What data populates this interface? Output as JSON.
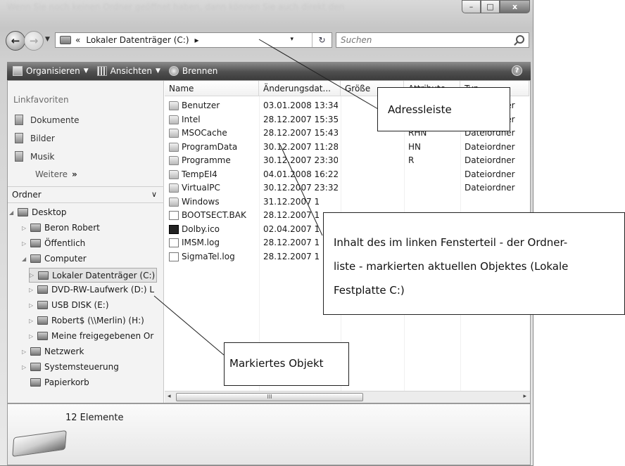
{
  "window": {
    "title_blurred": "Wenn Sie noch keinen Ordner geöffnet haben, dann können Sie auch direkt den",
    "caption_buttons": {
      "minimize": "–",
      "maximize": "□",
      "close": "x"
    }
  },
  "address_bar": {
    "prefix": "«",
    "location": "Lokaler Datenträger (C:)",
    "suffix_arrow": "▸",
    "dropdown": "▾",
    "refresh": "↻",
    "search_placeholder": "Suchen"
  },
  "command_bar": {
    "organize": "Organisieren",
    "views": "Ansichten",
    "burn": "Brennen",
    "help": "?"
  },
  "nav_pane": {
    "favorites_title": "Linkfavoriten",
    "favorites": [
      "Dokumente",
      "Bilder",
      "Musik"
    ],
    "more": "Weitere",
    "more_arrow": "»",
    "folders_title": "Ordner",
    "tree": [
      {
        "label": "Desktop",
        "expander": "◢"
      },
      {
        "label": "Beron Robert",
        "expander": "▷"
      },
      {
        "label": "Öffentlich",
        "expander": "▷"
      },
      {
        "label": "Computer",
        "expander": "◢"
      },
      {
        "label": "Lokaler Datenträger (C:)",
        "expander": "▷"
      },
      {
        "label": "DVD-RW-Laufwerk (D:) L",
        "expander": "▷"
      },
      {
        "label": "USB DISK (E:)",
        "expander": "▷"
      },
      {
        "label": "Robert$ (\\\\Merlin) (H:)",
        "expander": "▷"
      },
      {
        "label": "Meine freigegebenen Or",
        "expander": "▷"
      },
      {
        "label": "Netzwerk",
        "expander": "▷"
      },
      {
        "label": "Systemsteuerung",
        "expander": "▷"
      },
      {
        "label": "Papierkorb",
        "expander": ""
      }
    ]
  },
  "file_list": {
    "columns": [
      "Name",
      "Änderungsdat...",
      "Größe",
      "Attribute",
      "Typ"
    ],
    "rows": [
      {
        "name": "Benutzer",
        "date": "03.01.2008 13:34",
        "attr": "",
        "type": "Dateiordner",
        "icon": "folder"
      },
      {
        "name": "Intel",
        "date": "28.12.2007 15:35",
        "attr": "",
        "type": "Dateiordner",
        "icon": "folder"
      },
      {
        "name": "MSOCache",
        "date": "28.12.2007 15:43",
        "attr": "RHN",
        "type": "Dateiordner",
        "icon": "folder"
      },
      {
        "name": "ProgramData",
        "date": "30.12.2007 11:28",
        "attr": "HN",
        "type": "Dateiordner",
        "icon": "folder"
      },
      {
        "name": "Programme",
        "date": "30.12.2007 23:30",
        "attr": "R",
        "type": "Dateiordner",
        "icon": "folder"
      },
      {
        "name": "TempEI4",
        "date": "04.01.2008 16:22",
        "attr": "",
        "type": "Dateiordner",
        "icon": "folder"
      },
      {
        "name": "VirtualPC",
        "date": "30.12.2007 23:32",
        "attr": "",
        "type": "Dateiordner",
        "icon": "folder"
      },
      {
        "name": "Windows",
        "date": "31.12.2007 1",
        "attr": "",
        "type": "",
        "icon": "folder"
      },
      {
        "name": "BOOTSECT.BAK",
        "date": "28.12.2007 1",
        "attr": "",
        "type": "",
        "icon": "file"
      },
      {
        "name": "Dolby.ico",
        "date": "02.04.2007 1",
        "attr": "",
        "type": "",
        "icon": "dolby"
      },
      {
        "name": "IMSM.log",
        "date": "28.12.2007 1",
        "attr": "",
        "type": "",
        "icon": "file"
      },
      {
        "name": "SigmaTel.log",
        "date": "28.12.2007 1",
        "attr": "",
        "type": "",
        "icon": "file"
      }
    ],
    "scroll_grip": "III",
    "scroll_left": "◂",
    "scroll_right": "▸"
  },
  "details_pane": {
    "count": "12 Elemente"
  },
  "callouts": {
    "address": "Adressleiste",
    "content_lines": [
      "Inhalt des im linken Fensterteil  - der Ordner-",
      "liste - markierten aktuellen Objektes (Lokale",
      "Festplatte C:)"
    ],
    "marked": "Markiertes Objekt"
  },
  "colors": {
    "command_bar": "#4f4f4f",
    "selection": "#e3e3e3"
  }
}
